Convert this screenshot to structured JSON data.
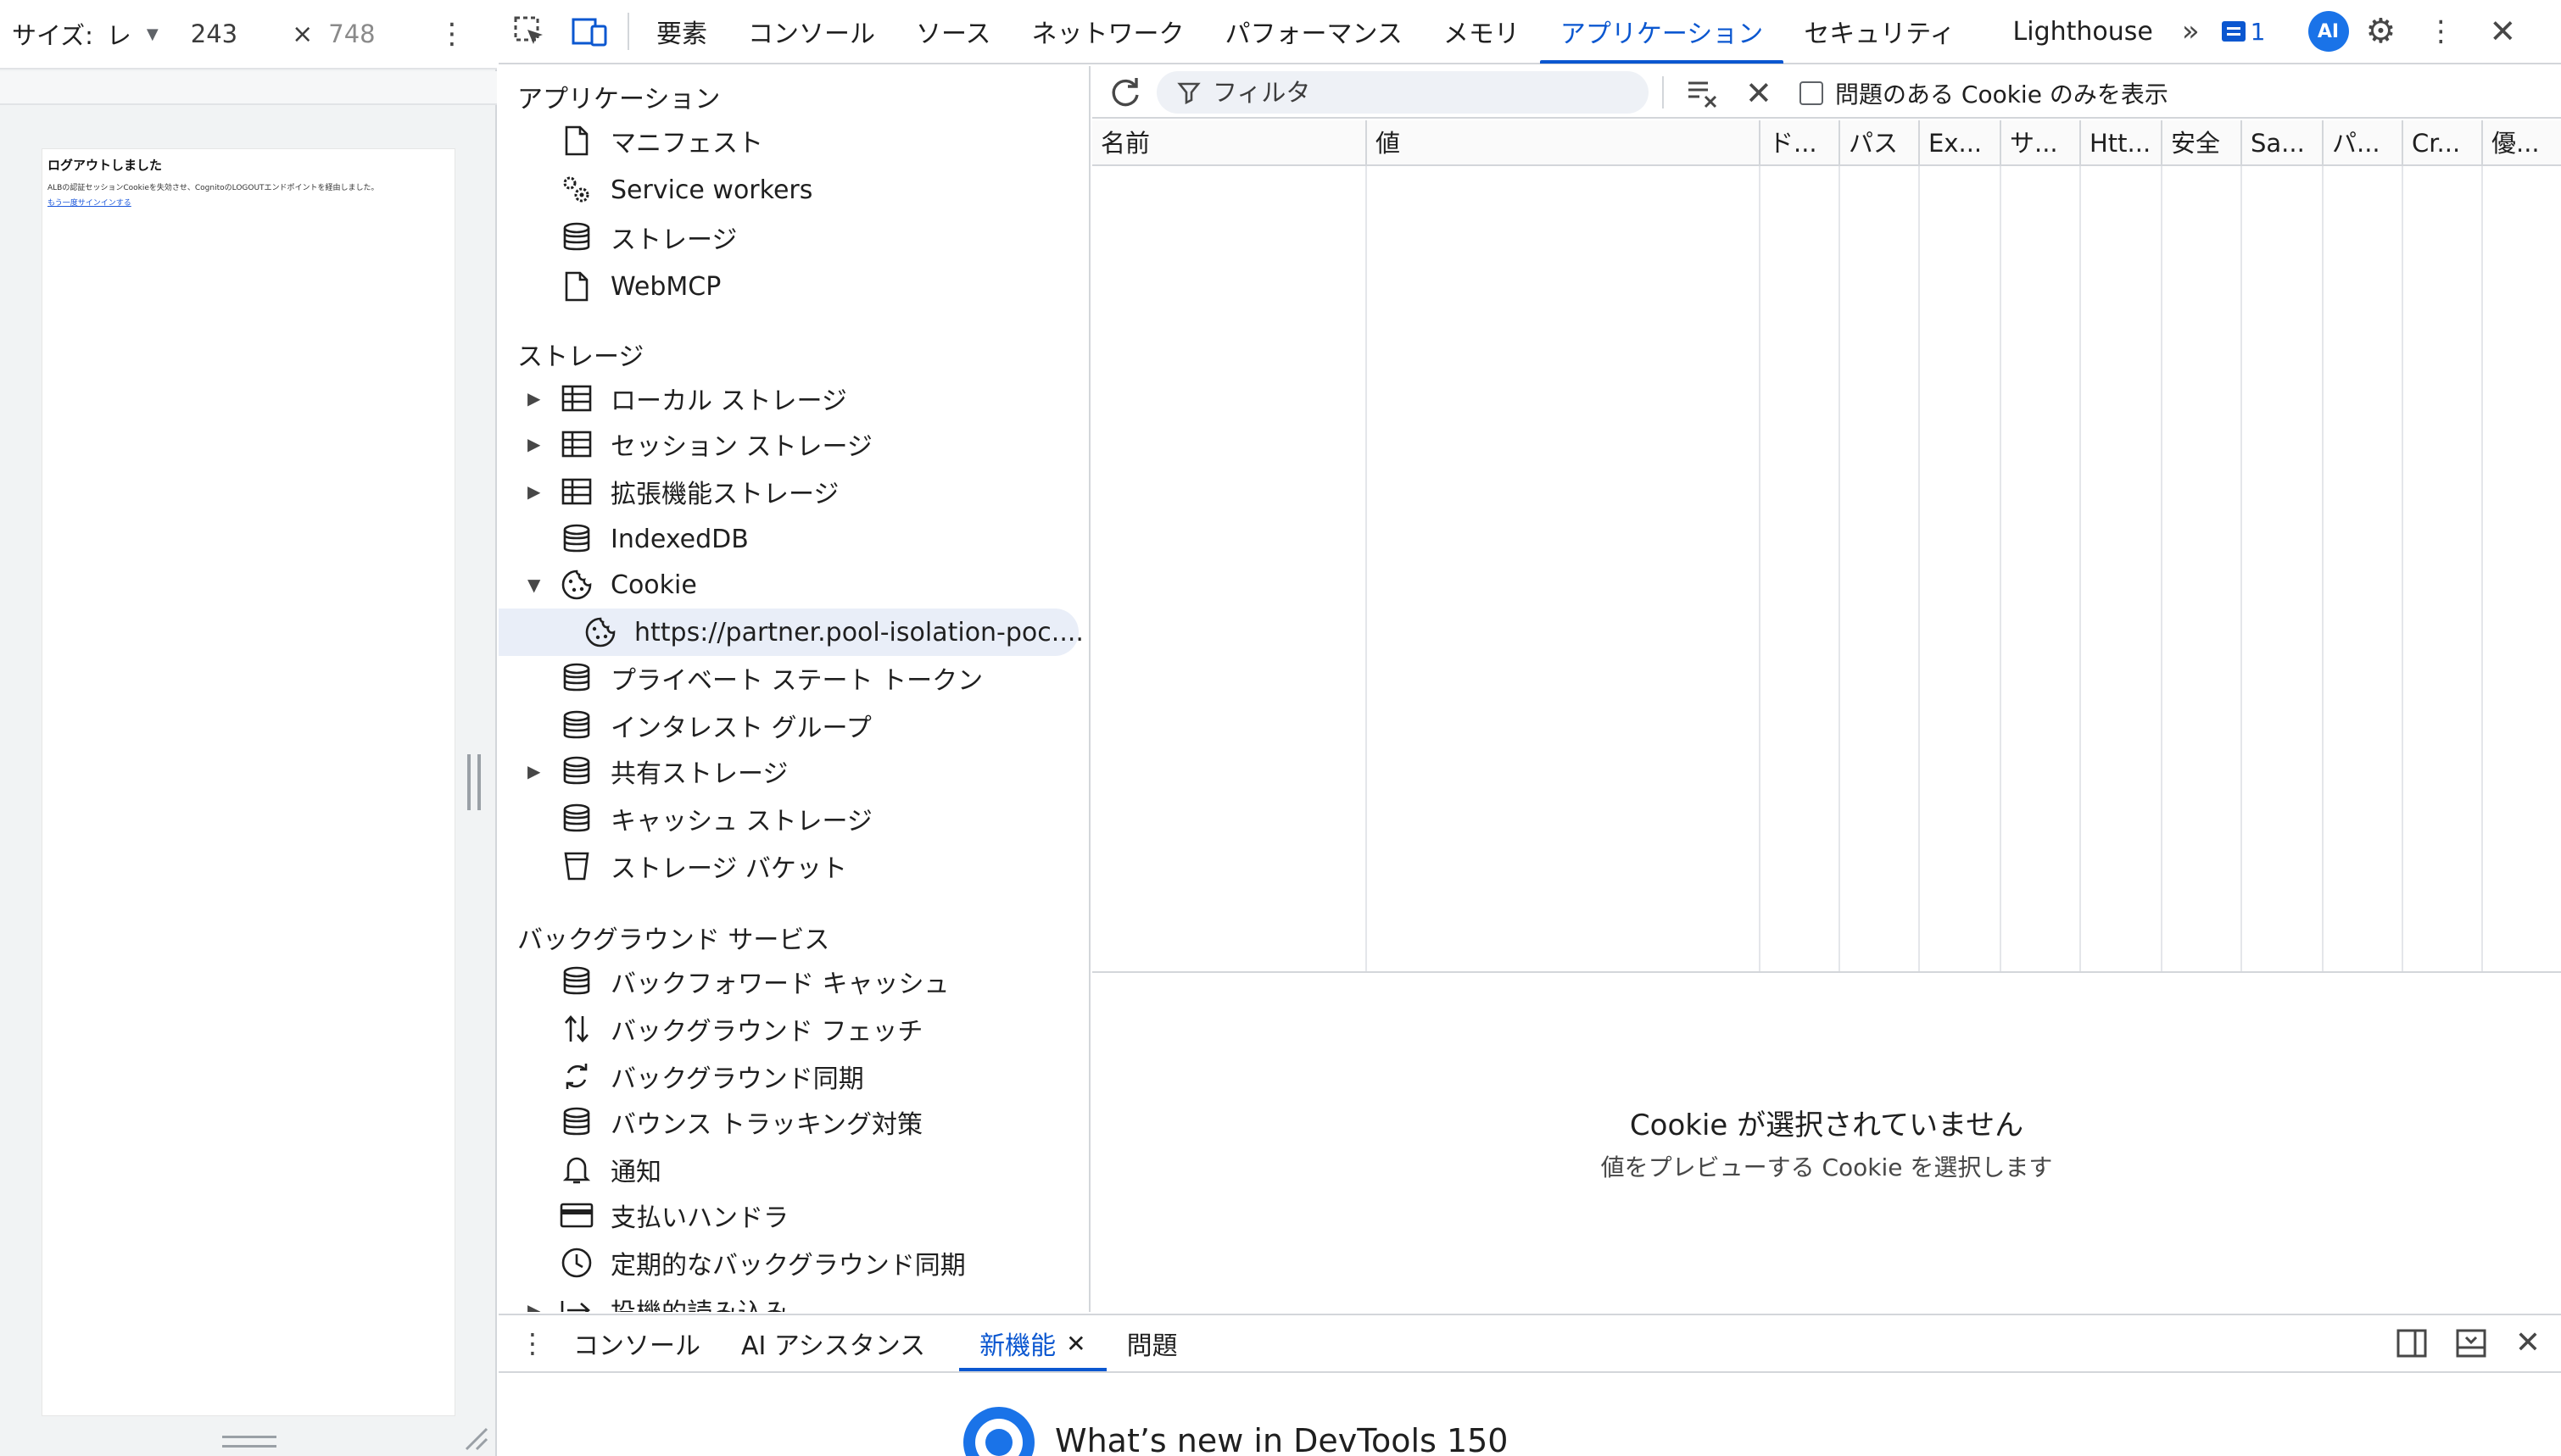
{
  "device_toolbar": {
    "size_label": "サイズ:",
    "size_select": "レ",
    "width": "243",
    "times": "×",
    "height": "748",
    "menu_icon": "more-vert-icon"
  },
  "page": {
    "heading": "ログアウトしました",
    "message": "ALBの認証セッションCookieを失効させ、CognitoのLOGOUTエンドポイントを経由しました。",
    "link": "もう一度サインインする"
  },
  "devtools_tabs": {
    "inspect_icon": "inspect-element-icon",
    "device_icon": "device-toolbar-icon",
    "tabs": [
      "要素",
      "コンソール",
      "ソース",
      "ネットワーク",
      "パフォーマンス",
      "メモリ",
      "アプリケーション",
      "セキュリティ"
    ],
    "active_tab": "アプリケーション",
    "lighthouse": "Lighthouse",
    "more": "»",
    "issues_count": "1",
    "ai_label": "AI",
    "settings_icon": "gear-icon",
    "menu_icon": "more-vert-icon",
    "close": "✕"
  },
  "sidebar": {
    "app_section": "アプリケーション",
    "app_items": [
      "マニフェスト",
      "Service workers",
      "ストレージ",
      "WebMCP"
    ],
    "storage_section": "ストレージ",
    "storage_items": [
      "ローカル ストレージ",
      "セッション ストレージ",
      "拡張機能ストレージ",
      "IndexedDB",
      "Cookie"
    ],
    "cookie_origin": "https://partner.pool-isolation-poc....",
    "storage_items_2": [
      "プライベート ステート トークン",
      "インタレスト グループ",
      "共有ストレージ",
      "キャッシュ ストレージ",
      "ストレージ バケット"
    ],
    "bg_section": "バックグラウンド サービス",
    "bg_items": [
      "バックフォワード キャッシュ",
      "バックグラウンド フェッチ",
      "バックグラウンド同期",
      "バウンス トラッキング対策",
      "通知",
      "支払いハンドラ",
      "定期的なバックグラウンド同期",
      "投機的読み込み"
    ]
  },
  "cookie_toolbar": {
    "filter_placeholder": "フィルタ",
    "issues_only_label": "問題のある Cookie のみを表示"
  },
  "cookie_table": {
    "columns": [
      "名前",
      "値",
      "ド...",
      "パス",
      "Ex...",
      "サ...",
      "Htt...",
      "安全",
      "Sa...",
      "パ...",
      "Cr...",
      "優..."
    ]
  },
  "preview": {
    "title": "Cookie が選択されていません",
    "subtitle": "値をプレビューする Cookie を選択します"
  },
  "drawer": {
    "tabs": [
      "コンソール",
      "AI アシスタンス",
      "新機能",
      "問題"
    ],
    "active_tab": "新機能",
    "close_tab": "✕",
    "whats_new_title": "What’s new in DevTools 150"
  },
  "colors": {
    "accent": "#0b57d0",
    "selected_bg": "#e9eef8",
    "border": "#d3d6da"
  }
}
